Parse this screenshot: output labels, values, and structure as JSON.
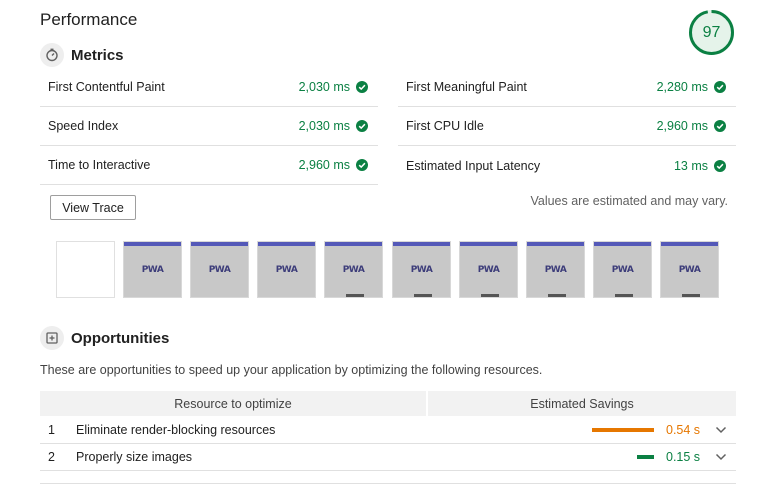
{
  "page": {
    "title": "Performance"
  },
  "score": {
    "value": "97",
    "fraction": 0.97,
    "color": "#0b8043"
  },
  "metrics_section": {
    "title": "Metrics",
    "icon": "stopwatch-icon"
  },
  "metrics": [
    {
      "label": "First Contentful Paint",
      "value": "2,030 ms",
      "status": "pass"
    },
    {
      "label": "First Meaningful Paint",
      "value": "2,280 ms",
      "status": "pass"
    },
    {
      "label": "Speed Index",
      "value": "2,030 ms",
      "status": "pass"
    },
    {
      "label": "First CPU Idle",
      "value": "2,960 ms",
      "status": "pass"
    },
    {
      "label": "Time to Interactive",
      "value": "2,960 ms",
      "status": "pass"
    },
    {
      "label": "Estimated Input Latency",
      "value": "13 ms",
      "status": "pass"
    }
  ],
  "actions": {
    "view_trace_label": "View Trace"
  },
  "estimate_note": "Values are estimated and may vary.",
  "filmstrip": {
    "frame_logo_text": "PWA",
    "frames": [
      "blank",
      "loaded",
      "loaded",
      "loaded",
      "loaded",
      "loaded",
      "loaded",
      "loaded",
      "loaded",
      "loaded"
    ]
  },
  "opportunities_section": {
    "title": "Opportunities",
    "icon": "opportunity-icon",
    "description": "These are opportunities to speed up your application by optimizing the following resources.",
    "columns": [
      "Resource to optimize",
      "Estimated Savings"
    ],
    "items": [
      {
        "index": "1",
        "name": "Eliminate render-blocking resources",
        "savings": "0.54 s",
        "savings_fraction": 1.0,
        "color": "#e67700"
      },
      {
        "index": "2",
        "name": "Properly size images",
        "savings": "0.15 s",
        "savings_fraction": 0.28,
        "color": "#0b8043"
      }
    ]
  },
  "colors": {
    "pass": "#0b8043",
    "average": "#e67700",
    "gauge_track": "#e5f3ea"
  }
}
